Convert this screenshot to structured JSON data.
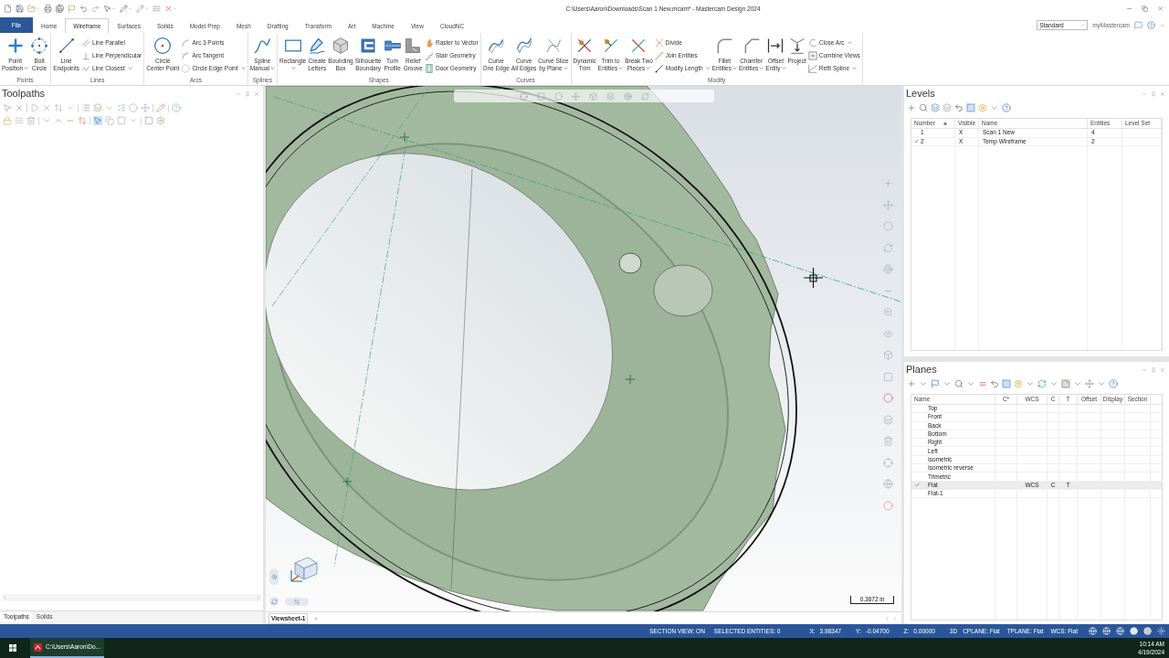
{
  "window": {
    "title": "C:\\Users\\Aaron\\Downloads\\Scan 1 New.mcam* - Mastercam Design 2024"
  },
  "ribbon_tabs": [
    {
      "label": "File",
      "kind": "file",
      "selected": false
    },
    {
      "label": "Home",
      "kind": "tab",
      "selected": false
    },
    {
      "label": "Wireframe",
      "kind": "tab",
      "selected": true
    },
    {
      "label": "Surfaces",
      "kind": "tab",
      "selected": false
    },
    {
      "label": "Solids",
      "kind": "tab",
      "selected": false
    },
    {
      "label": "Model Prep",
      "kind": "tab",
      "selected": false
    },
    {
      "label": "Mesh",
      "kind": "tab",
      "selected": false
    },
    {
      "label": "Drafting",
      "kind": "tab",
      "selected": false
    },
    {
      "label": "Transform",
      "kind": "tab",
      "selected": false
    },
    {
      "label": "Art",
      "kind": "tab",
      "selected": false
    },
    {
      "label": "Machine",
      "kind": "tab",
      "selected": false
    },
    {
      "label": "View",
      "kind": "tab",
      "selected": false
    },
    {
      "label": "CloudNC",
      "kind": "tab",
      "selected": false
    }
  ],
  "workspace_select": {
    "value": "Standard"
  },
  "account_link": "myMastercam",
  "ribbon_groups": [
    {
      "label": "Points",
      "columns": [
        {
          "kind": "large",
          "label": "Point\nPosition",
          "dropdown": true
        },
        {
          "kind": "large",
          "label": "Bolt\nCircle",
          "dropdown": false
        }
      ]
    },
    {
      "label": "Lines",
      "columns": [
        {
          "kind": "large",
          "label": "Line\nEndpoints",
          "dropdown": false
        },
        {
          "kind": "stack",
          "items": [
            {
              "label": "Line Parallel",
              "dropdown": false
            },
            {
              "label": "Line Perpendicular",
              "dropdown": false
            },
            {
              "label": "Line Closest",
              "dropdown": true
            }
          ]
        }
      ]
    },
    {
      "label": "Arcs",
      "columns": [
        {
          "kind": "large",
          "label": "Circle\nCenter Point",
          "dropdown": false
        },
        {
          "kind": "stack",
          "items": [
            {
              "label": "Arc 3 Points",
              "dropdown": false
            },
            {
              "label": "Arc Tangent",
              "dropdown": false
            },
            {
              "label": "Circle Edge Point",
              "dropdown": true
            }
          ]
        }
      ]
    },
    {
      "label": "Splines",
      "columns": [
        {
          "kind": "large",
          "label": "Spline\nManual",
          "dropdown": true
        }
      ]
    },
    {
      "label": "Shapes",
      "columns": [
        {
          "kind": "large",
          "label": "Rectangle",
          "dropdown": true
        },
        {
          "kind": "large",
          "label": "Create\nLetters",
          "dropdown": false
        },
        {
          "kind": "large",
          "label": "Bounding\nBox",
          "dropdown": false
        },
        {
          "kind": "large",
          "label": "Silhouette\nBoundary",
          "dropdown": false
        },
        {
          "kind": "large",
          "label": "Turn\nProfile",
          "dropdown": false
        },
        {
          "kind": "large",
          "label": "Relief\nGroove",
          "dropdown": false
        },
        {
          "kind": "stack",
          "items": [
            {
              "label": "Raster to Vector",
              "dropdown": false
            },
            {
              "label": "Stair Geometry",
              "dropdown": false
            },
            {
              "label": "Door Geometry",
              "dropdown": false
            }
          ]
        }
      ]
    },
    {
      "label": "Curves",
      "columns": [
        {
          "kind": "large",
          "label": "Curve\nOne Edge",
          "dropdown": false
        },
        {
          "kind": "large",
          "label": "Curve\nAll Edges",
          "dropdown": false
        },
        {
          "kind": "large",
          "label": "Curve Slice\nby Plane",
          "dropdown": true
        }
      ]
    },
    {
      "label": "Modify",
      "columns": [
        {
          "kind": "large",
          "label": "Dynamic\nTrim",
          "dropdown": false
        },
        {
          "kind": "large",
          "label": "Trim to\nEntities",
          "dropdown": true
        },
        {
          "kind": "large",
          "label": "Break Two\nPieces",
          "dropdown": true
        },
        {
          "kind": "stack",
          "items": [
            {
              "label": "Divide",
              "dropdown": false
            },
            {
              "label": "Join Entities",
              "dropdown": false
            },
            {
              "label": "Modify Length",
              "dropdown": true
            }
          ]
        },
        {
          "kind": "large",
          "label": "Fillet\nEntities",
          "dropdown": true
        },
        {
          "kind": "large",
          "label": "Chamfer\nEntities",
          "dropdown": true
        },
        {
          "kind": "large",
          "label": "Offset\nEntity",
          "dropdown": true
        },
        {
          "kind": "large",
          "label": "Project",
          "dropdown": false
        },
        {
          "kind": "stack",
          "items": [
            {
              "label": "Close Arc",
              "dropdown": true
            },
            {
              "label": "Combine Views",
              "dropdown": false
            },
            {
              "label": "Refit Spline",
              "dropdown": true
            }
          ]
        }
      ]
    }
  ],
  "toolpaths_panel": {
    "title": "Toolpaths",
    "tabs": [
      {
        "label": "Toolpaths",
        "selected": true
      },
      {
        "label": "Solids",
        "selected": false
      }
    ]
  },
  "viewport": {
    "scale_label": "0.3672 in",
    "tabs": [
      {
        "label": "Viewsheet-1",
        "selected": true
      }
    ]
  },
  "levels_panel": {
    "title": "Levels",
    "columns": [
      "Number",
      "Visible",
      "Name",
      "Entities",
      "Level Set"
    ],
    "rows": [
      {
        "number": "1",
        "active": false,
        "visible": "X",
        "name": "Scan 1 New",
        "entities": "4"
      },
      {
        "number": "2",
        "active": true,
        "visible": "X",
        "name": "Temp Wireframe",
        "entities": "2"
      }
    ]
  },
  "planes_panel": {
    "title": "Planes",
    "columns": [
      "Name",
      "C*",
      "WCS",
      "C",
      "T",
      "Offset",
      "Display",
      "Section"
    ],
    "rows": [
      {
        "name": "Top",
        "selected": false
      },
      {
        "name": "Front",
        "selected": false
      },
      {
        "name": "Back",
        "selected": false
      },
      {
        "name": "Bottom",
        "selected": false
      },
      {
        "name": "Right",
        "selected": false
      },
      {
        "name": "Left",
        "selected": false
      },
      {
        "name": "Isometric",
        "selected": false
      },
      {
        "name": "Isometric reverse",
        "selected": false
      },
      {
        "name": "Trimetric",
        "selected": false
      },
      {
        "name": "Flat",
        "selected": true,
        "wcs": "WCS",
        "c": "C",
        "t": "T"
      },
      {
        "name": "Flat-1",
        "selected": false
      }
    ]
  },
  "status_bar": {
    "items": [
      "SECTION VIEW: ON",
      "SELECTED ENTITIES: 0"
    ],
    "coordinates": [
      {
        "axis": "X:",
        "value": "3.98347"
      },
      {
        "axis": "Y:",
        "value": "-0.04700"
      },
      {
        "axis": "Z:",
        "value": "0.00000"
      }
    ],
    "mode": "3D",
    "planes": [
      "CPLANE: Flat",
      "TPLANE: Flat",
      "WCS: Flat"
    ]
  },
  "taskbar": {
    "app_label": "C:\\Users\\Aaron\\Do...",
    "time": "10:14 AM",
    "date": "4/19/2024"
  }
}
